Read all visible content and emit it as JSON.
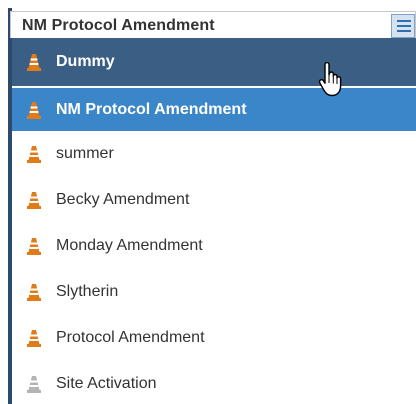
{
  "header": {
    "title": "NM Protocol Amendment",
    "menu_icon": "hamburger-icon"
  },
  "colors": {
    "hover_bg": "#3b5e85",
    "selected_bg": "#3a86c8",
    "cone_active": "#e07b1a",
    "cone_inactive": "#b4b4b4"
  },
  "list": {
    "items": [
      {
        "label": "Dummy",
        "icon": "traffic-cone-icon",
        "state": "hovered"
      },
      {
        "label": "NM Protocol Amendment",
        "icon": "traffic-cone-icon",
        "state": "selected"
      },
      {
        "label": "summer",
        "icon": "traffic-cone-icon",
        "state": "normal"
      },
      {
        "label": "Becky Amendment",
        "icon": "traffic-cone-icon",
        "state": "normal"
      },
      {
        "label": "Monday Amendment",
        "icon": "traffic-cone-icon",
        "state": "normal"
      },
      {
        "label": "Slytherin",
        "icon": "traffic-cone-icon",
        "state": "normal"
      },
      {
        "label": "Protocol Amendment",
        "icon": "traffic-cone-icon",
        "state": "normal"
      },
      {
        "label": "Site Activation",
        "icon": "traffic-cone-icon",
        "state": "disabled"
      }
    ]
  }
}
